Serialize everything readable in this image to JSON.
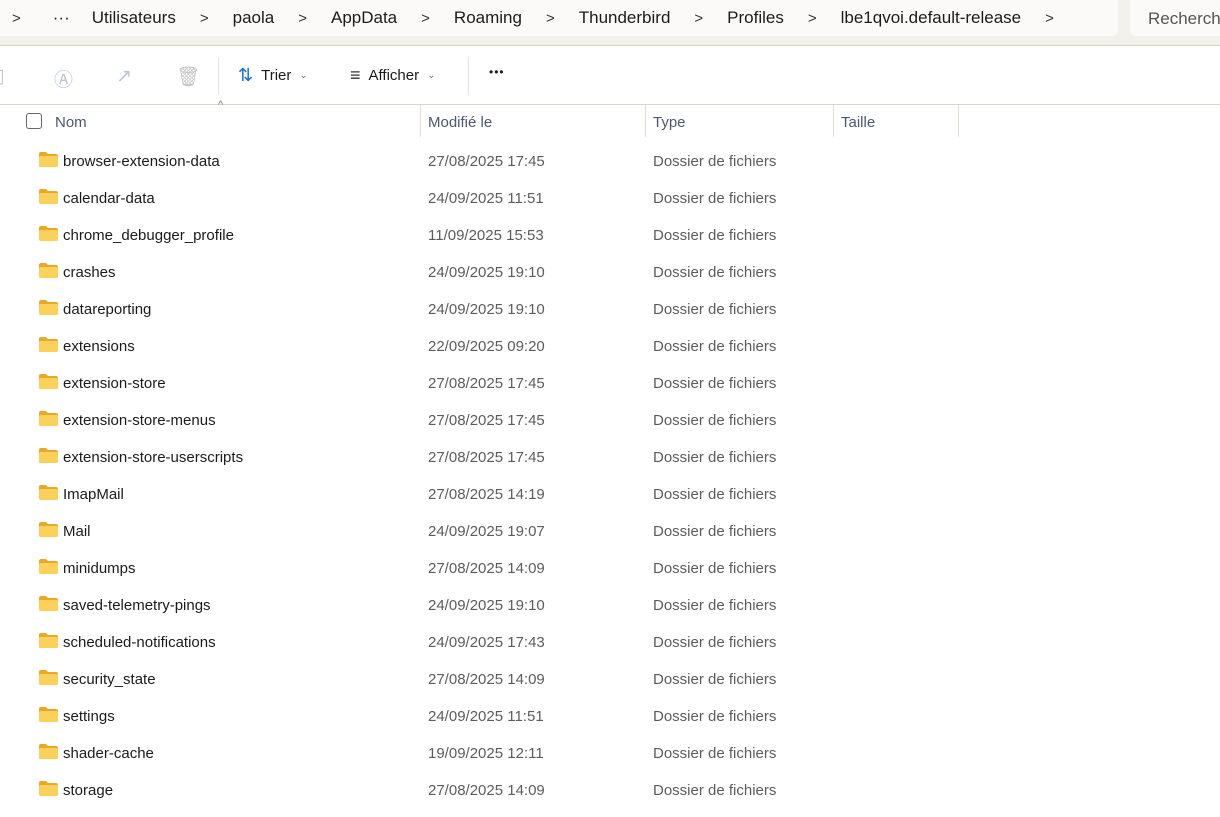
{
  "breadcrumb": {
    "items": [
      "Utilisateurs",
      "paola",
      "AppData",
      "Roaming",
      "Thunderbird",
      "Profiles",
      "lbe1qvoi.default-release"
    ],
    "overflow": "···"
  },
  "search": {
    "placeholder": "Rechercher"
  },
  "toolbar": {
    "sort_label": "Trier",
    "view_label": "Afficher",
    "more_label": "•••"
  },
  "columns": {
    "name": "Nom",
    "modified": "Modifié le",
    "type": "Type",
    "size": "Taille"
  },
  "files": [
    {
      "name": "browser-extension-data",
      "modified": "27/08/2025 17:45",
      "type": "Dossier de fichiers"
    },
    {
      "name": "calendar-data",
      "modified": "24/09/2025 11:51",
      "type": "Dossier de fichiers"
    },
    {
      "name": "chrome_debugger_profile",
      "modified": "11/09/2025 15:53",
      "type": "Dossier de fichiers"
    },
    {
      "name": "crashes",
      "modified": "24/09/2025 19:10",
      "type": "Dossier de fichiers"
    },
    {
      "name": "datareporting",
      "modified": "24/09/2025 19:10",
      "type": "Dossier de fichiers"
    },
    {
      "name": "extensions",
      "modified": "22/09/2025 09:20",
      "type": "Dossier de fichiers"
    },
    {
      "name": "extension-store",
      "modified": "27/08/2025 17:45",
      "type": "Dossier de fichiers"
    },
    {
      "name": "extension-store-menus",
      "modified": "27/08/2025 17:45",
      "type": "Dossier de fichiers"
    },
    {
      "name": "extension-store-userscripts",
      "modified": "27/08/2025 17:45",
      "type": "Dossier de fichiers"
    },
    {
      "name": "ImapMail",
      "modified": "27/08/2025 14:19",
      "type": "Dossier de fichiers"
    },
    {
      "name": "Mail",
      "modified": "24/09/2025 19:07",
      "type": "Dossier de fichiers"
    },
    {
      "name": "minidumps",
      "modified": "27/08/2025 14:09",
      "type": "Dossier de fichiers"
    },
    {
      "name": "saved-telemetry-pings",
      "modified": "24/09/2025 19:10",
      "type": "Dossier de fichiers"
    },
    {
      "name": "scheduled-notifications",
      "modified": "24/09/2025 17:43",
      "type": "Dossier de fichiers"
    },
    {
      "name": "security_state",
      "modified": "27/08/2025 14:09",
      "type": "Dossier de fichiers"
    },
    {
      "name": "settings",
      "modified": "24/09/2025 11:51",
      "type": "Dossier de fichiers"
    },
    {
      "name": "shader-cache",
      "modified": "19/09/2025 12:11",
      "type": "Dossier de fichiers"
    },
    {
      "name": "storage",
      "modified": "27/08/2025 14:09",
      "type": "Dossier de fichiers"
    }
  ]
}
